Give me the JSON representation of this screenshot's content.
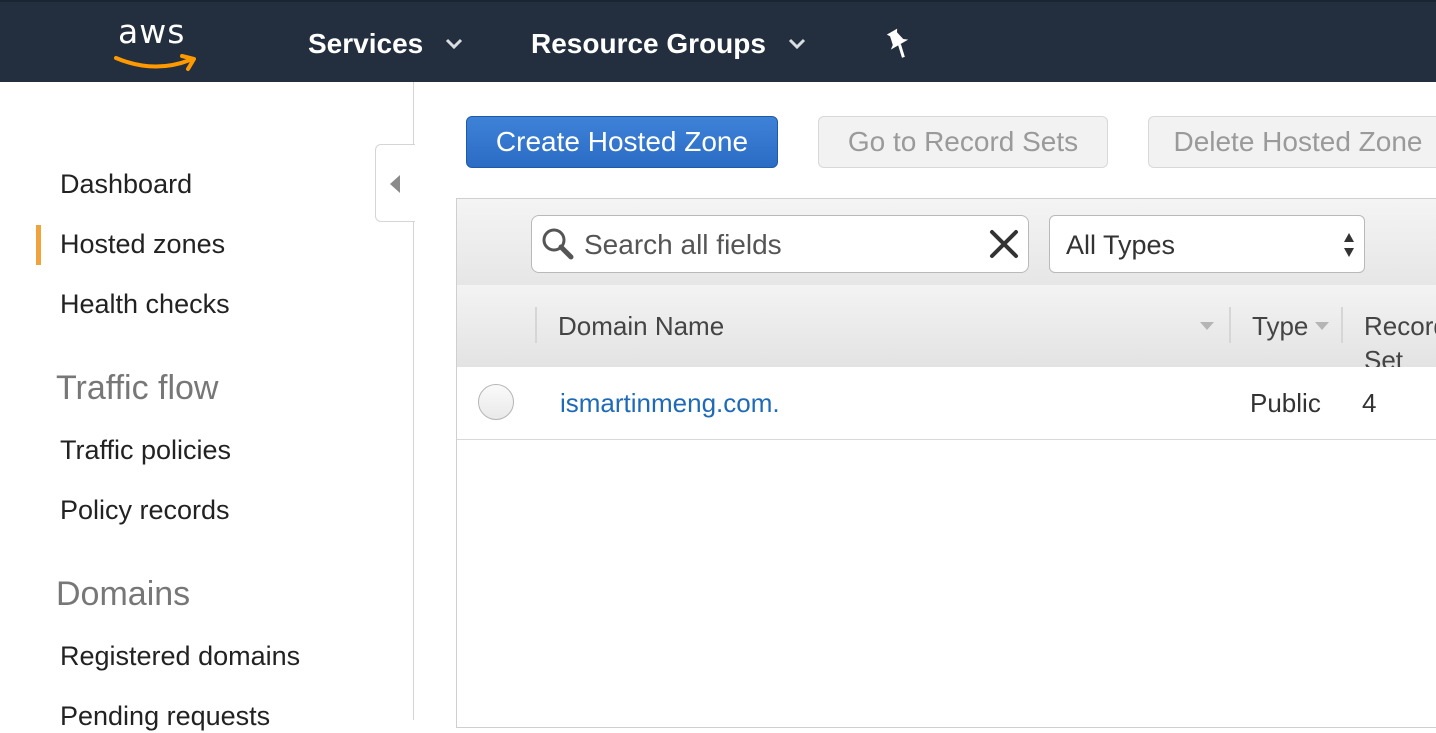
{
  "topnav": {
    "logo_text": "aws",
    "services_label": "Services",
    "resource_groups_label": "Resource Groups"
  },
  "sidebar": {
    "items": [
      {
        "label": "Dashboard"
      },
      {
        "label": "Hosted zones",
        "active": true
      },
      {
        "label": "Health checks"
      }
    ],
    "sections": [
      {
        "heading": "Traffic flow",
        "items": [
          "Traffic policies",
          "Policy records"
        ]
      },
      {
        "heading": "Domains",
        "items": [
          "Registered domains",
          "Pending requests"
        ]
      }
    ],
    "accent_color": "#f0a33b"
  },
  "toolbar": {
    "create_label": "Create Hosted Zone",
    "go_to_record_sets_label": "Go to Record Sets",
    "delete_label": "Delete Hosted Zone"
  },
  "filters": {
    "search_placeholder": "Search all fields",
    "type_selected": "All Types"
  },
  "table": {
    "columns": [
      "Domain Name",
      "Type",
      "Record Set Count"
    ],
    "rows": [
      {
        "domain": "ismartinmeng.com.",
        "type": "Public",
        "records": "4"
      }
    ]
  },
  "colors": {
    "nav_bg": "#232f3e",
    "primary_button": "#2b6cc4",
    "link": "#1f6ab8"
  }
}
